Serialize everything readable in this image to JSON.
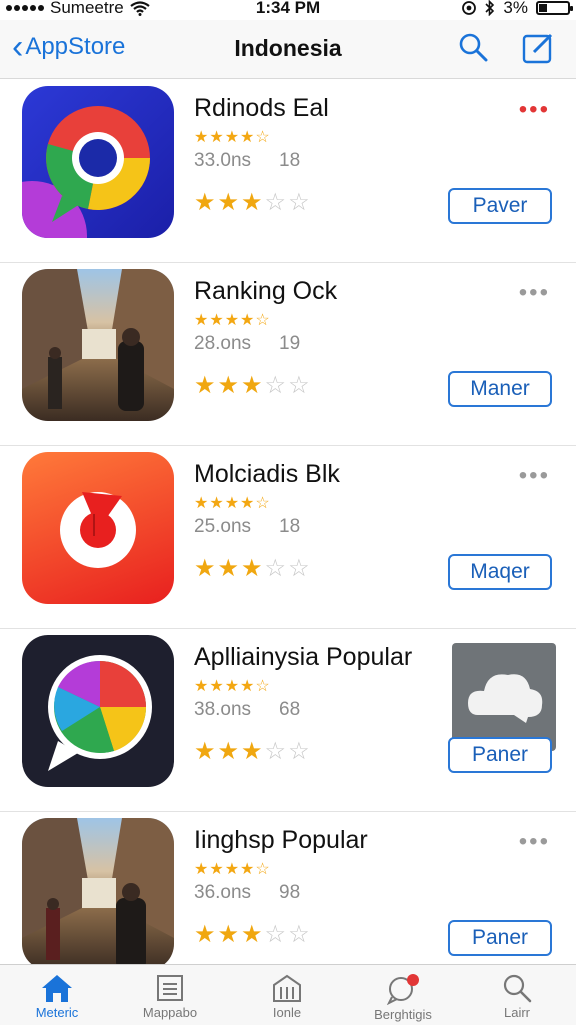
{
  "status": {
    "carrier": "Sumeetre",
    "time": "1:34 PM",
    "battery": "3%",
    "battery_level": 0.3
  },
  "nav": {
    "back_label": "AppStore",
    "title": "Indonesia"
  },
  "apps": [
    {
      "name": "Rdinods Eal",
      "size": "33.0ns",
      "count": "18",
      "button": "Paver",
      "rating": 3
    },
    {
      "name": "Ranking Ock",
      "size": "28.ons",
      "count": "19",
      "button": "Maner",
      "rating": 3
    },
    {
      "name": "Molciadis Blk",
      "size": "25.ons",
      "count": "18",
      "button": "Maqer",
      "rating": 3
    },
    {
      "name": "Aplliainysia Popular",
      "size": "38.ons",
      "count": "68",
      "button": "Paner",
      "rating": 3
    },
    {
      "name": "Iinghsp Popular",
      "size": "36.ons",
      "count": "98",
      "button": "Paner",
      "rating": 3
    }
  ],
  "tabs": [
    {
      "label": "Meteric",
      "icon": "home-icon",
      "active": true
    },
    {
      "label": "Mappabo",
      "icon": "list-icon"
    },
    {
      "label": "Ionle",
      "icon": "building-icon"
    },
    {
      "label": "Berghtigis",
      "icon": "bubble-icon"
    },
    {
      "label": "Lairr",
      "icon": "search-icon"
    }
  ],
  "colors": {
    "accent": "#1a73d9",
    "star": "#f0a710",
    "more_red": "#e23636"
  }
}
